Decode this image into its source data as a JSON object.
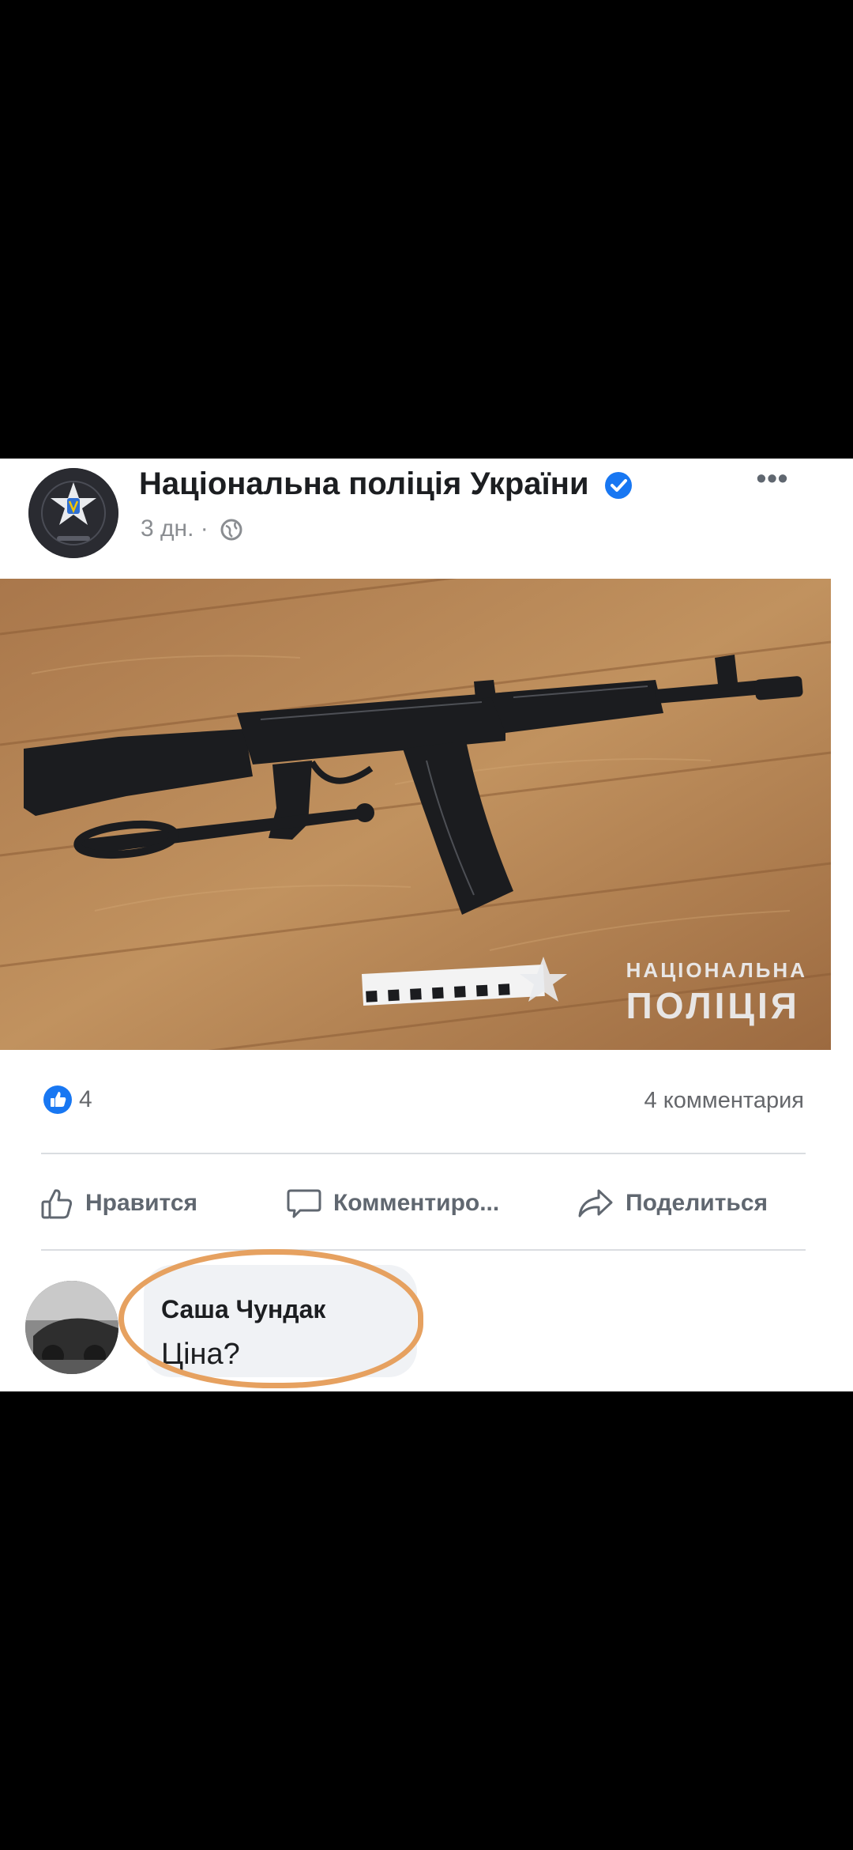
{
  "post": {
    "page_name": "Національна поліція України",
    "time_ago": "3 дн.",
    "meta_separator": "·",
    "more_label": "•••",
    "avatar_icon": "police-emblem-icon",
    "verified_icon": "verified-badge-icon",
    "privacy_icon": "globe-icon"
  },
  "photo": {
    "description_icon": "photo",
    "watermark_line1": "НАЦІОНАЛЬНА",
    "watermark_line2": "ПОЛІЦІЯ"
  },
  "reactions": {
    "count": "4",
    "comments": "4 комментария",
    "like_icon": "like-reaction-icon"
  },
  "actions": {
    "like": "Нравится",
    "comment": "Комментиро...",
    "share": "Поделиться"
  },
  "comment": {
    "author": "Саша Чундак",
    "text": "Ціна?"
  },
  "colors": {
    "background": "#000000",
    "card": "#ffffff",
    "accent_blue": "#1877f2",
    "muted_text": "#65676b",
    "highlight": "#e6a160"
  }
}
